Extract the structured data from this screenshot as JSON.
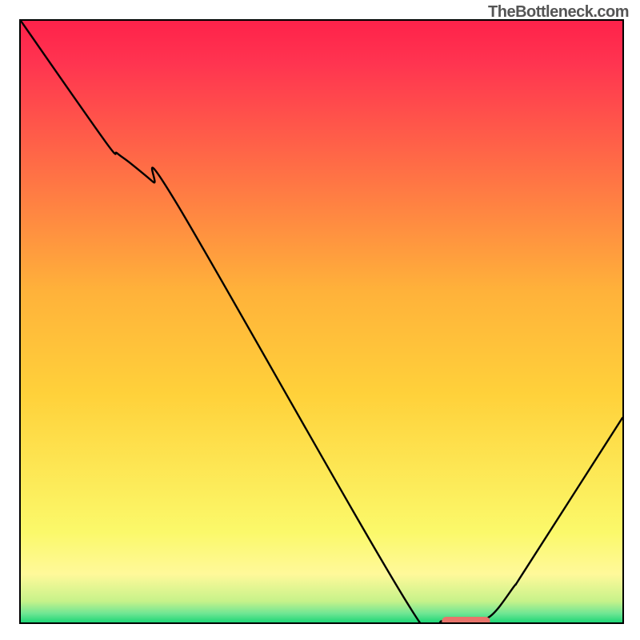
{
  "watermark": "TheBottleneck.com",
  "chart_data": {
    "type": "line",
    "title": "",
    "xlabel": "",
    "ylabel": "",
    "xlim": [
      0,
      100
    ],
    "ylim": [
      0,
      100
    ],
    "grid": false,
    "legend": false,
    "series": [
      {
        "name": "curve",
        "x": [
          0,
          14,
          16,
          18,
          22,
          26,
          65,
          70,
          74,
          78,
          82,
          84,
          100
        ],
        "values": [
          100,
          80,
          78,
          76.5,
          73.2,
          69.5,
          2.0,
          0.2,
          0.2,
          1.0,
          6.0,
          9.0,
          34
        ]
      }
    ],
    "marker": {
      "name": "minimum-marker",
      "x_start": 70,
      "x_end": 78,
      "y": 0.2,
      "color": "#e8746b"
    },
    "background_gradient": {
      "top": "#ff224a",
      "mid_upper": "#ffd13a",
      "mid_lower": "#fff99a",
      "bottom": "#1fd676"
    }
  }
}
